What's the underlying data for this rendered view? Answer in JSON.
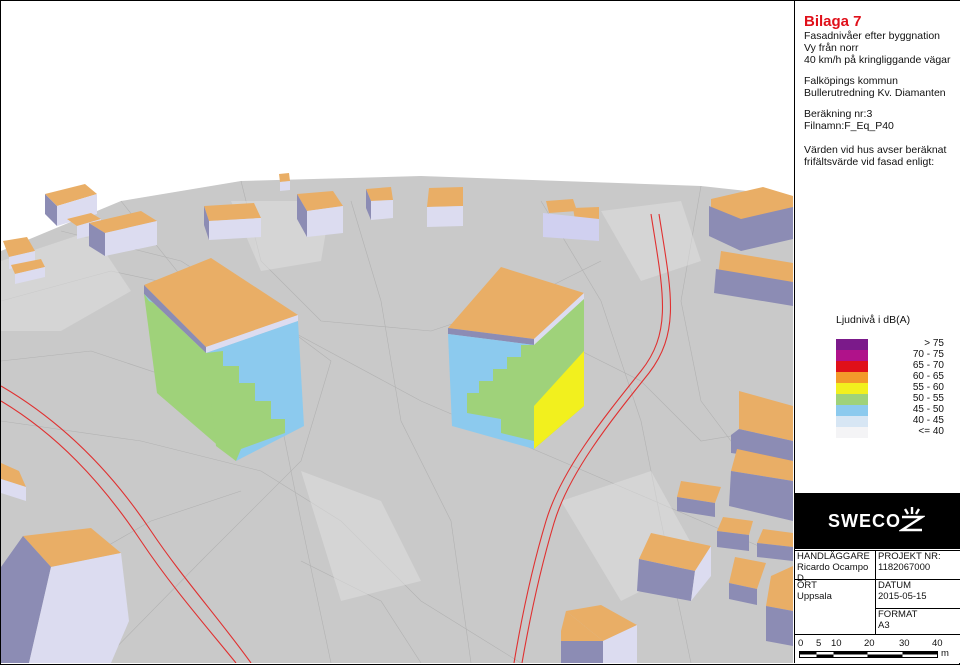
{
  "title": "Bilaga 7",
  "subtitle_lines": [
    "Fasadnivåer efter byggnation",
    "Vy från norr",
    "40 km/h på kringliggande vägar"
  ],
  "project_lines": [
    "Falköpings kommun",
    "Bullerutredning Kv. Diamanten"
  ],
  "calc_lines": [
    "Beräkning nr:3",
    "Filnamn:F_Eq_P40"
  ],
  "note_lines": [
    "Värden vid hus avser beräknat",
    "frifältsvärde vid fasad enligt:"
  ],
  "legend": {
    "title": "Ljudnivå i dB(A)",
    "items": [
      {
        "label": "> 75",
        "color": "#7b1a8a"
      },
      {
        "label": "70 - 75",
        "color": "#b0128a"
      },
      {
        "label": "65 - 70",
        "color": "#e0101a"
      },
      {
        "label": "60 - 65",
        "color": "#f39a2a"
      },
      {
        "label": "55 - 60",
        "color": "#f2f01e"
      },
      {
        "label": "50 - 55",
        "color": "#9fd27a"
      },
      {
        "label": "45 - 50",
        "color": "#8ccaee"
      },
      {
        "label": "40 - 45",
        "color": "#d7e6f4"
      },
      {
        "label": "<= 40",
        "color": "#f4f4f6"
      }
    ]
  },
  "logo": "SWECO",
  "info": {
    "handlaggare_label": "HANDLÄGGARE",
    "handlaggare_value": "Ricardo Ocampo D.",
    "projekt_label": "PROJEKT NR:",
    "projekt_value": "1182067000",
    "ort_label": "ORT",
    "ort_value": "Uppsala",
    "datum_label": "DATUM",
    "datum_value": "2015-05-15",
    "format_label": "FORMAT",
    "format_value": "A3"
  },
  "scale": {
    "ticks": [
      "0",
      "5",
      "10",
      "20",
      "30",
      "40"
    ],
    "unit": "m"
  },
  "colors": {
    "roof": "#e9ae66",
    "wall_side": "#8c8cb4",
    "wall_light": "#dcdcf0",
    "ground": "#c8c8c8",
    "road": "#e03030"
  }
}
